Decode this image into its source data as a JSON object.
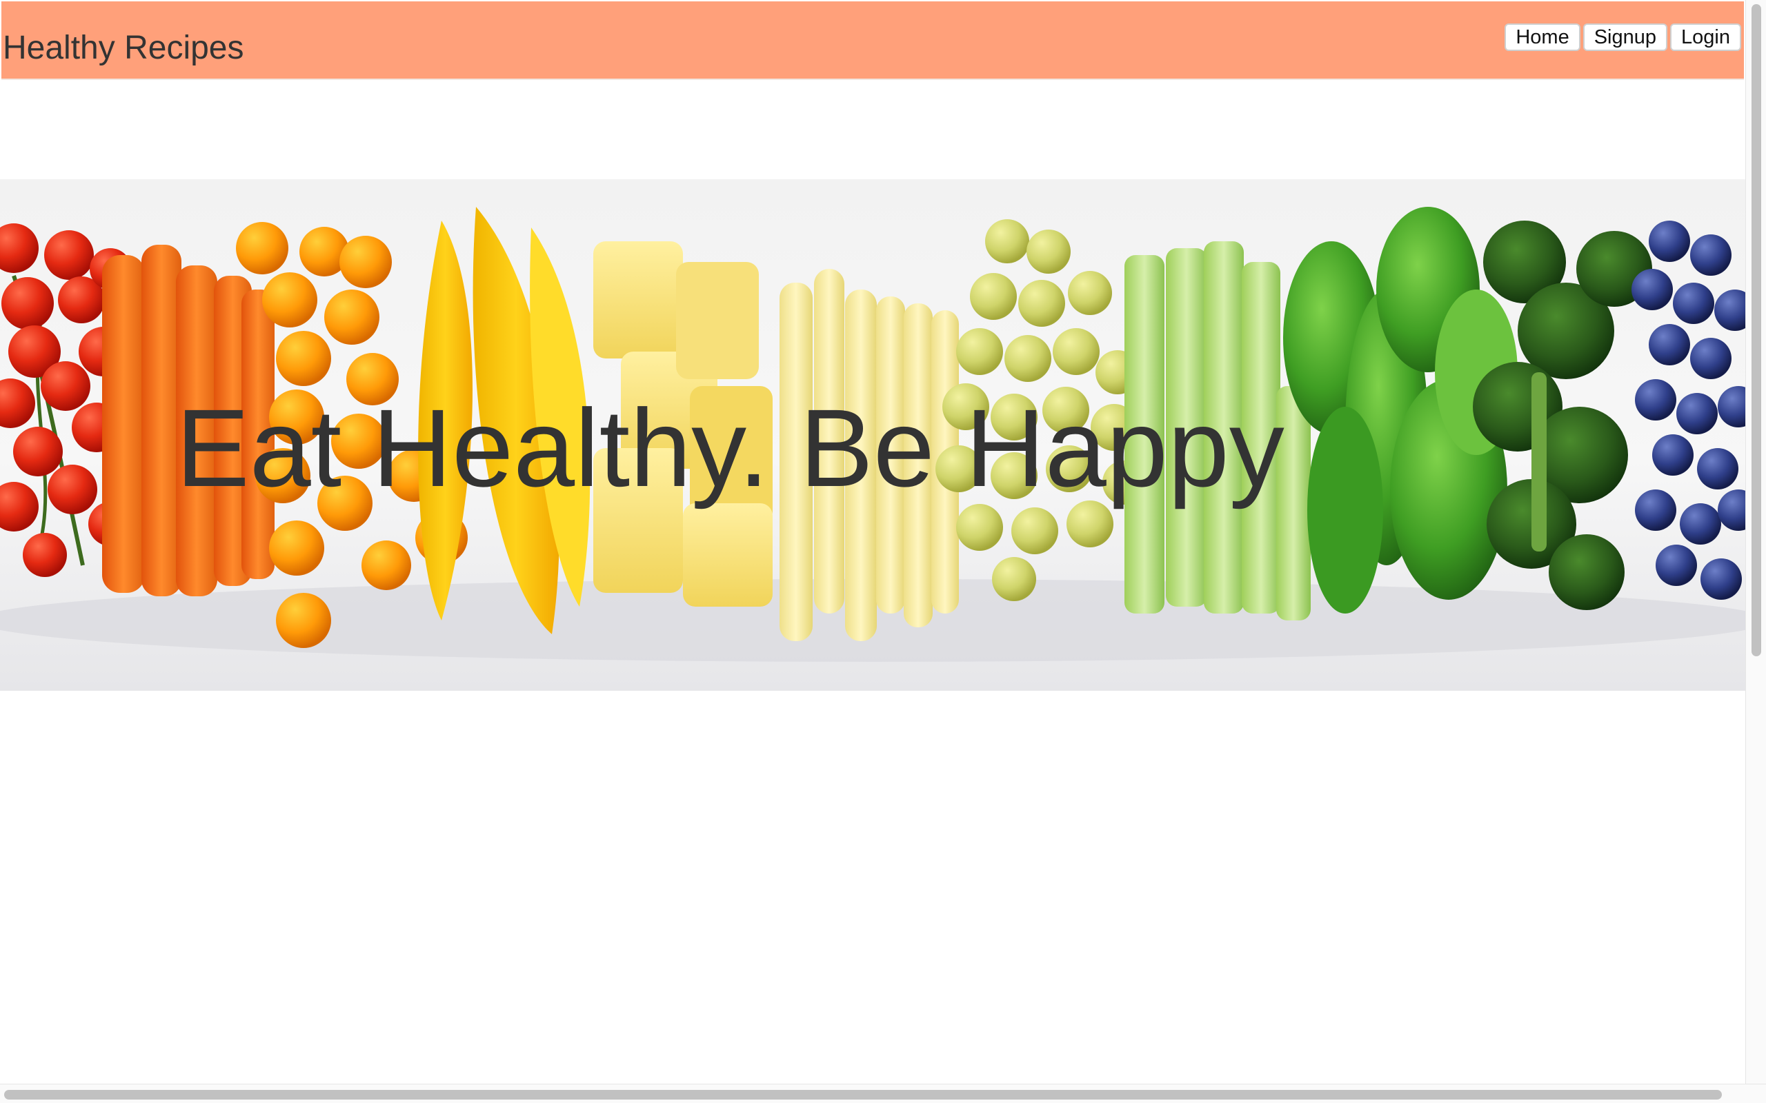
{
  "navbar": {
    "brand": "Healthy Recipes",
    "background_color": "#ffa07a",
    "buttons": [
      {
        "label": "Home"
      },
      {
        "label": "Signup"
      },
      {
        "label": "Login"
      }
    ]
  },
  "hero": {
    "headline": "Eat Healthy. Be Happy",
    "image_subject": "rainbow row of fruits and vegetables: tomatoes, carrots, orange tomatoes, mango, pineapple, baby corn, grapes, celery, green beans, broccoli, blueberries"
  },
  "colors": {
    "text": "#333333",
    "navbar": "#ffa07a",
    "button_background": "#ffffff"
  }
}
